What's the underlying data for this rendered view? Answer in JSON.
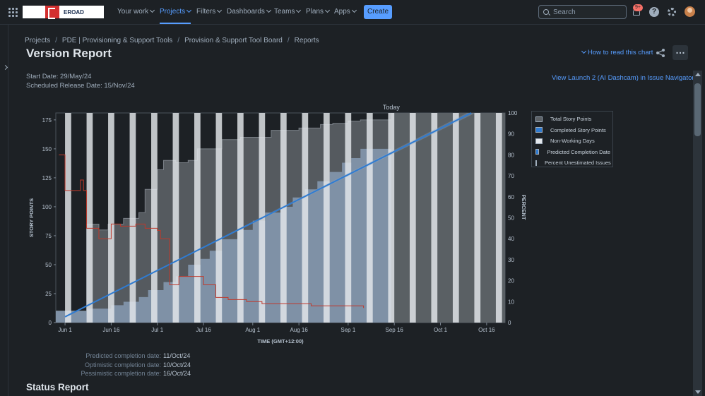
{
  "nav": {
    "logo_text": "EROAD",
    "items": [
      {
        "label": "Your work"
      },
      {
        "label": "Projects"
      },
      {
        "label": "Filters"
      },
      {
        "label": "Dashboards"
      },
      {
        "label": "Teams"
      },
      {
        "label": "Plans"
      },
      {
        "label": "Apps"
      }
    ],
    "create_label": "Create",
    "search_placeholder": "Search",
    "notification_count": "9+"
  },
  "breadcrumb": [
    "Projects",
    "PDE | Provisioning & Support Tools",
    "Provision & Support Tool Board",
    "Reports"
  ],
  "page": {
    "title": "Version Report",
    "how_to_read": "How to read this chart",
    "start_date": "Start Date: 29/May/24",
    "release_date": "Scheduled Release Date: 15/Nov/24",
    "view_link": "View Launch 2 (AI Dashcam) in Issue Navigator"
  },
  "chart_data": {
    "type": "area",
    "today_label": "Today",
    "xlabel": "TIME (GMT+12:00)",
    "ylabel": "STORY POINTS",
    "y2label": "PERCENT",
    "x_ticks": [
      "Jun 1",
      "Jun 16",
      "Jul 1",
      "Jul 16",
      "Aug 1",
      "Aug 16",
      "Sep 1",
      "Sep 16",
      "Oct 1",
      "Oct 16"
    ],
    "y_ticks": [
      0,
      25,
      50,
      75,
      100,
      125,
      150,
      175
    ],
    "y2_ticks": [
      0,
      10,
      20,
      30,
      40,
      50,
      60,
      70,
      80,
      90,
      100
    ],
    "ylim": [
      0,
      181
    ],
    "y2lim": [
      0,
      100
    ],
    "xlim": [
      "2024-05-29",
      "2024-10-22"
    ],
    "today": "2024-09-15",
    "series": [
      {
        "name": "Total Story Points",
        "color": "#5c6166",
        "points": [
          [
            "2024-05-29",
            10
          ],
          [
            "2024-06-06",
            10
          ],
          [
            "2024-06-08",
            85
          ],
          [
            "2024-06-12",
            80
          ],
          [
            "2024-06-15",
            85
          ],
          [
            "2024-06-20",
            90
          ],
          [
            "2024-06-25",
            95
          ],
          [
            "2024-06-27",
            115
          ],
          [
            "2024-07-01",
            132
          ],
          [
            "2024-07-03",
            140
          ],
          [
            "2024-07-07",
            138
          ],
          [
            "2024-07-11",
            140
          ],
          [
            "2024-07-14",
            150
          ],
          [
            "2024-07-18",
            150
          ],
          [
            "2024-07-22",
            158
          ],
          [
            "2024-07-28",
            160
          ],
          [
            "2024-08-02",
            160
          ],
          [
            "2024-08-07",
            166
          ],
          [
            "2024-08-13",
            166
          ],
          [
            "2024-08-16",
            168
          ],
          [
            "2024-08-20",
            168
          ],
          [
            "2024-08-23",
            171
          ],
          [
            "2024-08-27",
            172
          ],
          [
            "2024-09-01",
            174
          ],
          [
            "2024-09-05",
            175
          ],
          [
            "2024-09-15",
            175
          ]
        ]
      },
      {
        "name": "Completed Story Points",
        "color": "#8ea4be",
        "points": [
          [
            "2024-05-29",
            10
          ],
          [
            "2024-06-06",
            10
          ],
          [
            "2024-06-08",
            12
          ],
          [
            "2024-06-12",
            12
          ],
          [
            "2024-06-16",
            15
          ],
          [
            "2024-06-20",
            18
          ],
          [
            "2024-06-25",
            22
          ],
          [
            "2024-06-28",
            28
          ],
          [
            "2024-07-03",
            35
          ],
          [
            "2024-07-07",
            40
          ],
          [
            "2024-07-11",
            50
          ],
          [
            "2024-07-15",
            55
          ],
          [
            "2024-07-18",
            62
          ],
          [
            "2024-07-22",
            72
          ],
          [
            "2024-07-27",
            80
          ],
          [
            "2024-08-01",
            88
          ],
          [
            "2024-08-05",
            95
          ],
          [
            "2024-08-10",
            100
          ],
          [
            "2024-08-14",
            108
          ],
          [
            "2024-08-18",
            115
          ],
          [
            "2024-08-22",
            122
          ],
          [
            "2024-08-26",
            130
          ],
          [
            "2024-08-30",
            138
          ],
          [
            "2024-09-02",
            142
          ],
          [
            "2024-09-05",
            150
          ],
          [
            "2024-09-15",
            150
          ]
        ]
      },
      {
        "name": "Percent Unestimated Issues",
        "color": "#c0392b",
        "points": [
          [
            "2024-05-30",
            80
          ],
          [
            "2024-06-01",
            63
          ],
          [
            "2024-06-05",
            63
          ],
          [
            "2024-06-06",
            68
          ],
          [
            "2024-06-07",
            63
          ],
          [
            "2024-06-08",
            45
          ],
          [
            "2024-06-12",
            40
          ],
          [
            "2024-06-16",
            47
          ],
          [
            "2024-06-19",
            46
          ],
          [
            "2024-06-24",
            47
          ],
          [
            "2024-06-27",
            45
          ],
          [
            "2024-07-01",
            44
          ],
          [
            "2024-07-02",
            40
          ],
          [
            "2024-07-05",
            18
          ],
          [
            "2024-07-08",
            22
          ],
          [
            "2024-07-13",
            22
          ],
          [
            "2024-07-16",
            18
          ],
          [
            "2024-07-20",
            12
          ],
          [
            "2024-07-24",
            11
          ],
          [
            "2024-07-30",
            10
          ],
          [
            "2024-08-04",
            9
          ],
          [
            "2024-08-10",
            9
          ],
          [
            "2024-08-20",
            8
          ],
          [
            "2024-08-30",
            8
          ],
          [
            "2024-09-06",
            7
          ]
        ]
      }
    ],
    "predicted_line": [
      [
        "2024-06-01",
        5
      ],
      [
        "2024-10-11",
        181
      ]
    ],
    "legend": [
      {
        "label": "Total Story Points",
        "color": "#5c6166"
      },
      {
        "label": "Completed Story Points",
        "color": "#2f7bd1"
      },
      {
        "label": "Non-Working Days",
        "color": "#e4e8ec"
      },
      {
        "label": "Predicted Completion Date",
        "color": "#2f7bd1"
      },
      {
        "label": "Percent Unestimated Issues",
        "color": "#c0392b"
      }
    ]
  },
  "forecast": [
    {
      "label": "Predicted completion date:",
      "value": "11/Oct/24"
    },
    {
      "label": "Optimistic completion date:",
      "value": "10/Oct/24"
    },
    {
      "label": "Pessimistic completion date:",
      "value": "16/Oct/24"
    }
  ],
  "status_title": "Status Report"
}
